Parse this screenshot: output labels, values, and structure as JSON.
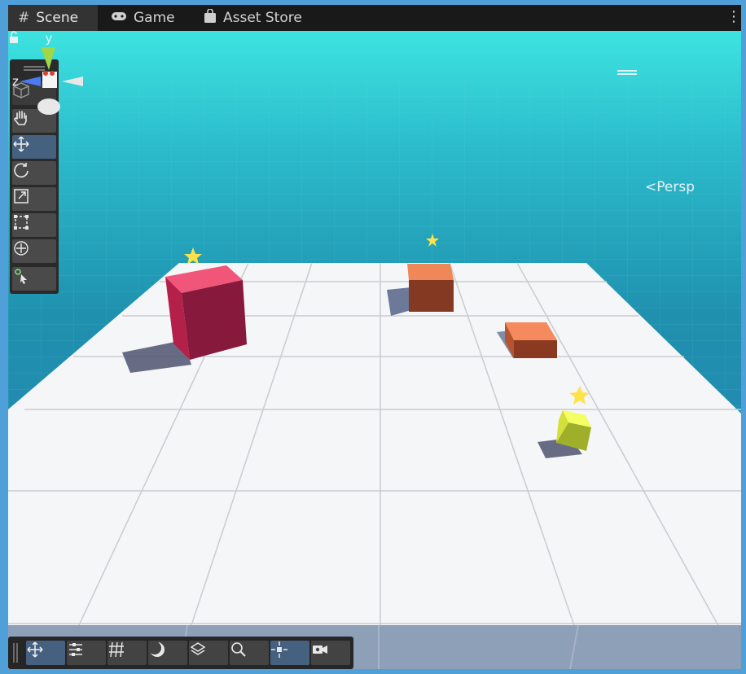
{
  "tabs": [
    {
      "label": "Scene",
      "icon": "hash-icon",
      "active": true
    },
    {
      "label": "Game",
      "icon": "gamepad-icon",
      "active": false
    },
    {
      "label": "Asset Store",
      "icon": "shopping-bag-icon",
      "active": false
    }
  ],
  "menu_icon": "kebab-menu-icon",
  "tools": [
    {
      "name": "view-cube",
      "icon": "cube-icon",
      "active": false
    },
    {
      "name": "hand-tool",
      "icon": "hand-icon",
      "active": false
    },
    {
      "name": "move-tool",
      "icon": "move-icon",
      "active": true
    },
    {
      "name": "rotate-tool",
      "icon": "rotate-icon",
      "active": false
    },
    {
      "name": "scale-tool",
      "icon": "scale-icon",
      "active": false
    },
    {
      "name": "rect-tool",
      "icon": "rect-icon",
      "active": false
    },
    {
      "name": "transform-tool",
      "icon": "transform-icon",
      "active": false
    },
    {
      "name": "custom-tool",
      "icon": "custom-tool-icon",
      "active": false
    }
  ],
  "gizmo": {
    "y_label": "y",
    "z_label": "z",
    "projection": "Persp",
    "colors": {
      "y": "#9fd64a",
      "z": "#4b7bf0",
      "x": "#e8e8e8"
    }
  },
  "overlay_bar": [
    {
      "name": "move",
      "icon": "move-icon",
      "active": true
    },
    {
      "name": "settings",
      "icon": "sliders-icon",
      "active": false
    },
    {
      "name": "grid",
      "icon": "grid-icon",
      "active": false
    },
    {
      "name": "shading",
      "icon": "shading-moon-icon",
      "active": false
    },
    {
      "name": "layers",
      "icon": "layers-icon",
      "active": false
    },
    {
      "name": "search",
      "icon": "search-icon",
      "active": false
    },
    {
      "name": "snap",
      "icon": "snap-icon",
      "active": true
    },
    {
      "name": "camera",
      "icon": "camera-icon",
      "active": false
    }
  ],
  "scene_colors": {
    "sky_top": "#3de0e0",
    "sea": "#1f8fae",
    "floor": "#f4f6f7",
    "red_box": "#8a1a3a",
    "orange_box": "#d9653f",
    "yellow_box": "#cfe03a",
    "star": "#ffe24a"
  }
}
